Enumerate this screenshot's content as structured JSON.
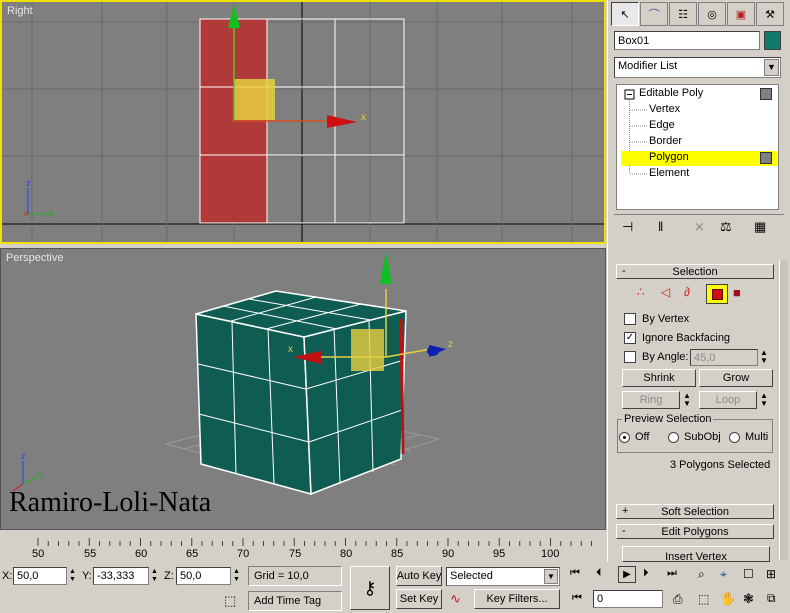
{
  "viewports": {
    "top_label": "Right",
    "bottom_label": "Perspective",
    "watermark": "Ramiro-Loli-Nata",
    "axis_x": "x",
    "axis_z": "z",
    "axis_y": "y"
  },
  "panel": {
    "object_name": "Box01",
    "object_color": "#0f7a6a",
    "modifier_list": "Modifier List",
    "stack": [
      {
        "label": "Editable Poly",
        "selected": false
      },
      {
        "label": "Vertex",
        "selected": false
      },
      {
        "label": "Edge",
        "selected": false
      },
      {
        "label": "Border",
        "selected": false
      },
      {
        "label": "Polygon",
        "selected": true
      },
      {
        "label": "Element",
        "selected": false
      }
    ],
    "selection_rollout": {
      "title": "Selection",
      "by_vertex": "By Vertex",
      "ignore_backfacing": "Ignore Backfacing",
      "by_angle": "By Angle:",
      "angle_value": "45,0",
      "shrink": "Shrink",
      "grow": "Grow",
      "ring": "Ring",
      "loop": "Loop",
      "preview_title": "Preview Selection",
      "preview_off": "Off",
      "preview_subobj": "SubObj",
      "preview_multi": "Multi",
      "status": "3 Polygons Selected"
    },
    "soft_selection": "Soft Selection",
    "edit_polygons": "Edit Polygons",
    "next_rollout_partial": "Insert Vertex"
  },
  "timeline": {
    "ticks": [
      "50",
      "55",
      "60",
      "65",
      "70",
      "75",
      "80",
      "85",
      "90",
      "95",
      "100"
    ]
  },
  "status_bar": {
    "x_label": "X:",
    "x_value": "50,0",
    "y_label": "Y:",
    "y_value": "-33,333",
    "z_label": "Z:",
    "z_value": "50,0",
    "grid": "Grid = 10,0",
    "add_time_tag": "Add Time Tag",
    "auto_key": "Auto Key",
    "set_key": "Set Key",
    "selected_dropdown": "Selected",
    "key_filters": "Key Filters...",
    "frame_value": "0"
  },
  "colors": {
    "viewport_bg": "#7f7f7f",
    "active_border": "#f0e000",
    "selection_yellow": "#ffff00",
    "cube_color": "#0f5c52"
  }
}
